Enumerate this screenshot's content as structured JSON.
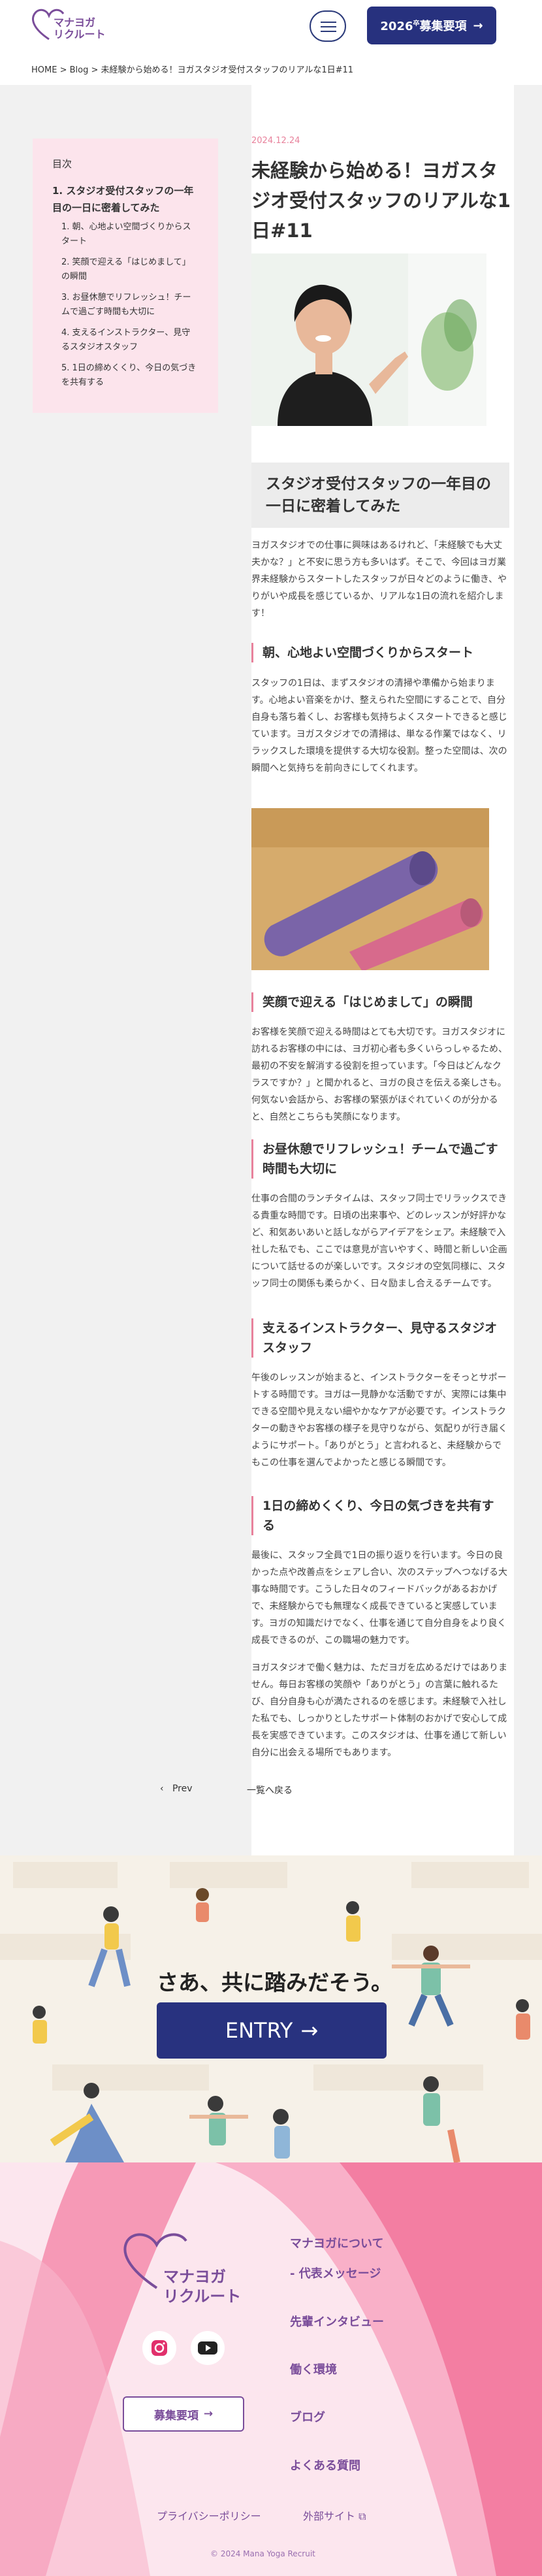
{
  "header": {
    "logo_text": "マナヨガ\nリクルート",
    "recruit_label": "2026",
    "recruit_label_sup": "卒",
    "recruit_label2": "募集要項"
  },
  "breadcrumb": "HOME > Blog > 未経験から始める！ヨガスタジオ受付スタッフのリアルな1日#11",
  "toc": {
    "title": "目次",
    "h1": "1. スタジオ受付スタッフの一年目の一日に密着してみた",
    "items": [
      "1. 朝、心地よい空間づくりからスタート",
      "2. 笑顔で迎える「はじめまして」の瞬間",
      "3. お昼休憩でリフレッシュ！チームで過ごす時間も大切に",
      "4. 支えるインストラクター、見守るスタジオスタッフ",
      "5. 1日の締めくくり、今日の気づきを共有する"
    ]
  },
  "article": {
    "date": "2024.12.24",
    "title": "未経験から始める！ヨガスタジオ受付スタッフのリアルな1日#11",
    "h2": "スタジオ受付スタッフの一年目の一日に密着してみた",
    "intro": "ヨガスタジオでの仕事に興味はあるけれど、「未経験でも大丈夫かな？」と不安に思う方も多いはず。そこで、今回はヨガ業界未経験からスタートしたスタッフが日々どのように働き、やりがいや成長を感じているか、リアルな1日の流れを紹介します！",
    "s1_title": "朝、心地よい空間づくりからスタート",
    "s1_text": "スタッフの1日は、まずスタジオの清掃や準備から始まります。心地よい音楽をかけ、整えられた空間にすることで、自分自身も落ち着くし、お客様も気持ちよくスタートできると感じています。ヨガスタジオでの清掃は、単なる作業ではなく、リラックスした環境を提供する大切な役割。整った空間は、次の瞬間へと気持ちを前向きにしてくれます。",
    "s2_title": "笑顔で迎える「はじめまして」の瞬間",
    "s2_text": "お客様を笑顔で迎える時間はとても大切です。ヨガスタジオに訪れるお客様の中には、ヨガ初心者も多くいらっしゃるため、最初の不安を解消する役割を担っています。「今日はどんなクラスですか？」と聞かれると、ヨガの良さを伝える楽しさも。何気ない会話から、お客様の緊張がほぐれていくのが分かると、自然とこちらも笑顔になります。",
    "s3_title": "お昼休憩でリフレッシュ！チームで過ごす時間も大切に",
    "s3_text": "仕事の合間のランチタイムは、スタッフ同士でリラックスできる貴重な時間です。日頃の出来事や、どのレッスンが好評かなど、和気あいあいと話しながらアイデアをシェア。未経験で入社した私でも、ここでは意見が言いやすく、時間と新しい企画について話せるのが楽しいです。スタジオの空気同様に、スタッフ同士の関係も柔らかく、日々励まし合えるチームです。",
    "s4_title": "支えるインストラクター、見守るスタジオスタッフ",
    "s4_text": "午後のレッスンが始まると、インストラクターをそっとサポートする時間です。ヨガは一見静かな活動ですが、実際には集中できる空間や見えない細やかなケアが必要です。インストラクターの動きやお客様の様子を見守りながら、気配りが行き届くようにサポート。「ありがとう」と言われると、未経験からでもこの仕事を選んでよかったと感じる瞬間です。",
    "s5_title": "1日の締めくくり、今日の気づきを共有する",
    "s5_text": "最後に、スタッフ全員で1日の振り返りを行います。今日の良かった点や改善点をシェアし合い、次のステップへつなげる大事な時間です。こうした日々のフィードバックがあるおかげで、未経験からでも無理なく成長できていると実感しています。ヨガの知識だけでなく、仕事を通じて自分自身をより良く成長できるのが、この職場の魅力です。",
    "closing": "ヨガスタジオで働く魅力は、ただヨガを広めるだけではありません。毎日お客様の笑顔や「ありがとう」の言葉に触れるたび、自分自身も心が満たされるのを感じます。未経験で入社した私でも、しっかりとしたサポート体制のおかげで安心して成長を実感できています。このスタジオは、仕事を通じて新しい自分に出会える場所でもあります。"
  },
  "pager": {
    "prev": "Prev",
    "list": "一覧へ戻る"
  },
  "entry": {
    "title": "さあ、共に踏みだそう。",
    "button": "ENTRY"
  },
  "footer": {
    "logo_text": "マナヨガ\nリクルート",
    "recruit": "募集要項",
    "nav": [
      "マナヨガについて",
      "- 代表メッセージ",
      "先輩インタビュー",
      "働く環境",
      "ブログ",
      "よくある質問"
    ],
    "privacy": "プライバシーポリシー",
    "external": "外部サイト",
    "copyright": "© 2024 Mana Yoga Recruit"
  },
  "colors": {
    "navy": "#27317e",
    "pink": "#e8829c",
    "purple": "#7a4d9a"
  }
}
